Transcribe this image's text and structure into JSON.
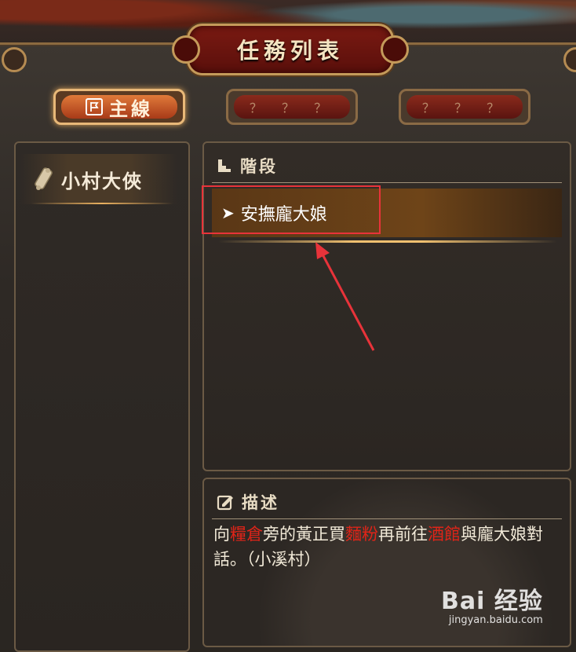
{
  "window": {
    "title": "任務列表"
  },
  "tabs": [
    {
      "label": "主線",
      "active": true
    },
    {
      "label": "？ ？ ？",
      "active": false
    },
    {
      "label": "？ ？ ？",
      "active": false
    }
  ],
  "chapters": [
    {
      "label": "小村大俠"
    }
  ],
  "stage_section": {
    "heading": "階段",
    "quests": [
      {
        "label": "安撫龐大娘",
        "selected": true
      }
    ]
  },
  "description_section": {
    "heading": "描述",
    "segments": [
      {
        "text": "向",
        "highlight": false
      },
      {
        "text": "糧倉",
        "highlight": true
      },
      {
        "text": "旁的黃正買",
        "highlight": false
      },
      {
        "text": "麵粉",
        "highlight": true
      },
      {
        "text": "再前往",
        "highlight": false
      },
      {
        "text": "酒館",
        "highlight": true
      },
      {
        "text": "與龐大娘對話。（小溪村）",
        "highlight": false
      }
    ]
  },
  "watermark": {
    "logo": "Bai 经验",
    "url": "jingyan.baidu.com"
  },
  "colors": {
    "highlight_text": "#e02418",
    "annotation_box": "#e8333a",
    "accent_gold": "#e8b060"
  }
}
